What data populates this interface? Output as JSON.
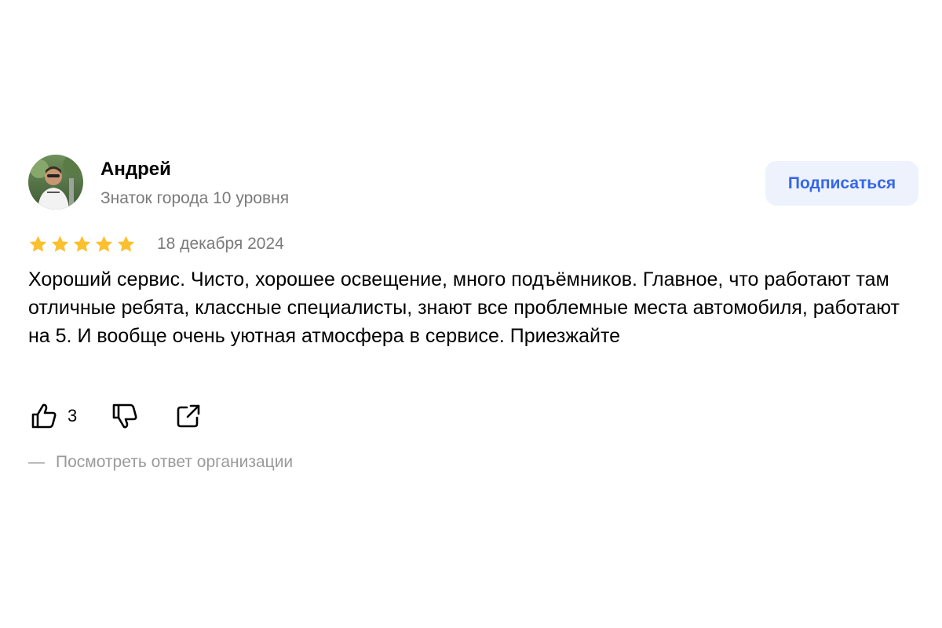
{
  "review": {
    "author": {
      "name": "Андрей",
      "level": "Знаток города 10 уровня",
      "avatar_icon": "user-photo-avatar"
    },
    "subscribe_label": "Подписаться",
    "rating": 5,
    "rating_max": 5,
    "date": "18 декабря 2024",
    "text": "Хороший сервис. Чисто, хорошее освещение, много подъёмников. Главное, что работают там отличные ребята, классные специалисты, знают все проблемные места автомобиля, работают на 5. И вообще очень уютная атмосфера в сервисе. Приезжайте",
    "likes": "3",
    "org_response_dash": "—",
    "org_response_label": "Посмотреть ответ организации"
  },
  "colors": {
    "accent": "#3566ea",
    "subscribe_bg": "#edf2fd",
    "star": "#fbc02d",
    "muted_text": "#7a7a7a"
  },
  "icons": {
    "like": "thumbs-up-icon",
    "dislike": "thumbs-down-icon",
    "share": "share-icon",
    "star": "star-icon"
  }
}
